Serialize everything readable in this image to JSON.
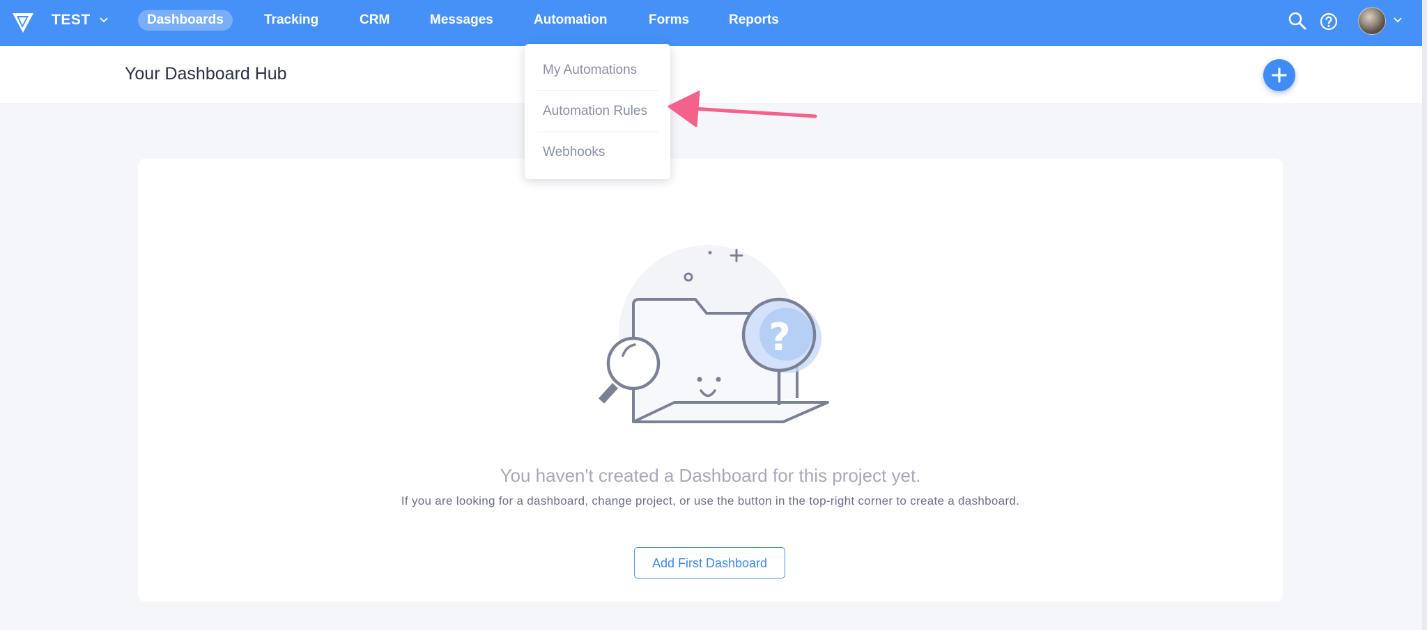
{
  "nav": {
    "project": "TEST",
    "items": [
      {
        "label": "Dashboards",
        "active": true
      },
      {
        "label": "Tracking"
      },
      {
        "label": "CRM"
      },
      {
        "label": "Messages"
      },
      {
        "label": "Automation"
      },
      {
        "label": "Forms"
      },
      {
        "label": "Reports"
      }
    ],
    "icons": [
      "logo-icon",
      "search-icon",
      "help-icon",
      "avatar",
      "chevron-down-icon"
    ]
  },
  "automation_menu": {
    "items": [
      "My Automations",
      "Automation Rules",
      "Webhooks"
    ]
  },
  "header": {
    "title": "Your Dashboard Hub",
    "add_icon": "plus-icon"
  },
  "empty_state": {
    "title": "You haven't created a Dashboard for this project yet.",
    "description": "If you are looking for a dashboard, change project, or use the button in the top-right corner to create a dashboard.",
    "button_label": "Add First Dashboard"
  },
  "colors": {
    "nav_bg": "#4691f7",
    "accent": "#3f8cf5",
    "annotation_arrow": "#f4618b",
    "page_bg": "#f5f6fa"
  }
}
